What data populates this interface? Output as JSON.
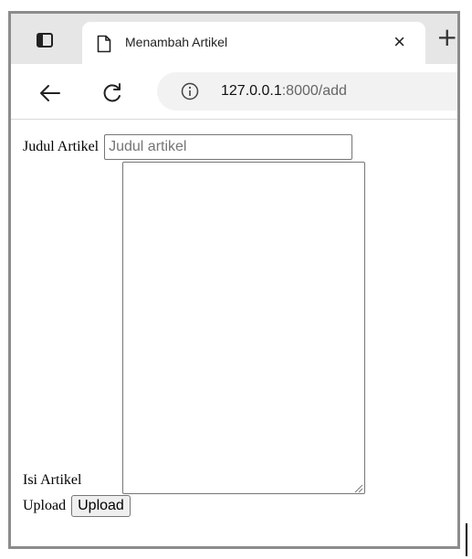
{
  "browser": {
    "tab": {
      "title": "Menambah Artikel",
      "close_glyph": "×"
    },
    "new_tab_glyph": "+",
    "toolbar": {
      "back_icon": "arrow-left-icon",
      "reload_icon": "reload-icon",
      "url_host": "127.0.0.1",
      "url_rest": ":8000/add"
    }
  },
  "form": {
    "title_label": "Judul Artikel",
    "title_placeholder": "Judul artikel",
    "title_value": "",
    "content_label": "Isi Artikel",
    "content_value": "",
    "upload_label": "Upload",
    "upload_button": "Upload"
  }
}
